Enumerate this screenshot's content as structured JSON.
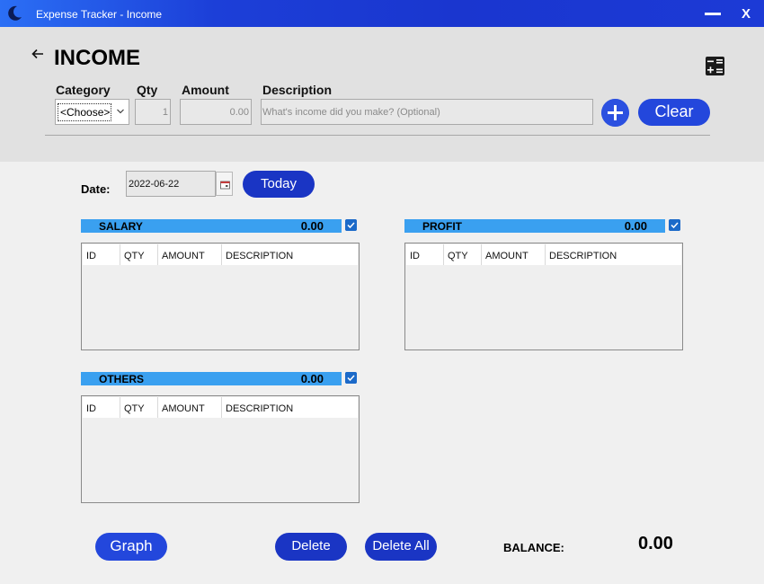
{
  "window": {
    "title": "Expense Tracker - Income",
    "close_label": "X",
    "colors": {
      "titlebar": "#1a36cf",
      "accent": "#1a35c4",
      "section_bar": "#3aa0f0"
    }
  },
  "header": {
    "title": "INCOME",
    "back_icon": "arrow-left-icon",
    "calculator_icon": "calculator-icon"
  },
  "form": {
    "category_label": "Category",
    "qty_label": "Qty",
    "amount_label": "Amount",
    "description_label": "Description",
    "category_value": "<Choose>",
    "qty_value": "1",
    "amount_value": "0.00",
    "description_placeholder": "What's income did you make? (Optional)",
    "clear_label": "Clear"
  },
  "date": {
    "label": "Date:",
    "value": "2022-06-22",
    "today_label": "Today"
  },
  "categories": [
    {
      "name": "SALARY",
      "total": "0.00",
      "checked": true
    },
    {
      "name": "PROFIT",
      "total": "0.00",
      "checked": true
    },
    {
      "name": "OTHERS",
      "total": "0.00",
      "checked": true
    }
  ],
  "table_columns": [
    "ID",
    "QTY",
    "AMOUNT",
    "DESCRIPTION"
  ],
  "footer": {
    "graph_label": "Graph",
    "delete_label": "Delete",
    "delete_all_label": "Delete All",
    "balance_label": "BALANCE:",
    "balance_value": "0.00"
  }
}
